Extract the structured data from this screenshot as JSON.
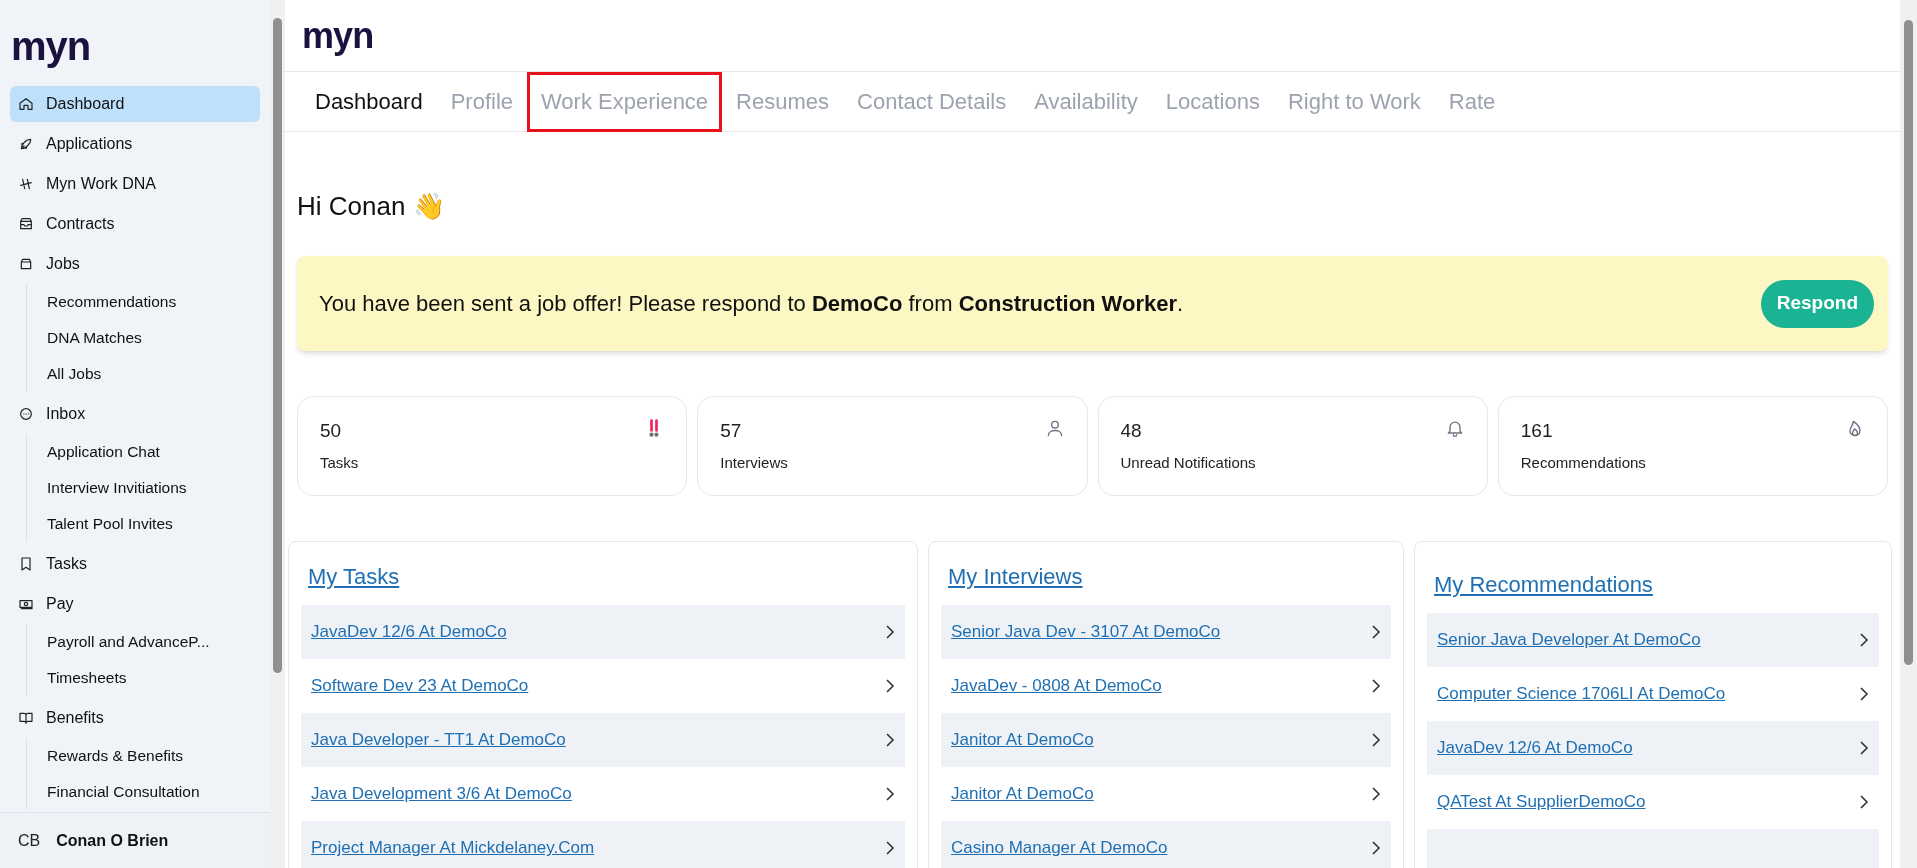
{
  "sidebar": {
    "logo": "myn",
    "items": [
      {
        "label": "Dashboard",
        "selected": true
      },
      {
        "label": "Applications",
        "selected": false
      },
      {
        "label": "Myn Work DNA",
        "selected": false
      },
      {
        "label": "Contracts",
        "selected": false
      },
      {
        "label": "Jobs",
        "selected": false,
        "children": [
          {
            "label": "Recommendations",
            "selected": false
          },
          {
            "label": "DNA Matches",
            "selected": false
          },
          {
            "label": "All Jobs",
            "selected": false
          }
        ]
      },
      {
        "label": "Inbox",
        "selected": false,
        "children": [
          {
            "label": "Application Chat",
            "selected": false
          },
          {
            "label": "Interview Invitiations",
            "selected": false
          },
          {
            "label": "Talent Pool Invites",
            "selected": false
          }
        ]
      },
      {
        "label": "Tasks",
        "selected": false
      },
      {
        "label": "Pay",
        "selected": false,
        "children": [
          {
            "label": "Payroll and AdvanceP...",
            "selected": false
          },
          {
            "label": "Timesheets",
            "selected": false
          }
        ]
      },
      {
        "label": "Benefits",
        "selected": false,
        "children": [
          {
            "label": "Rewards & Benefits",
            "selected": false
          },
          {
            "label": "Financial Consultation",
            "selected": false
          }
        ]
      }
    ],
    "user": {
      "initials": "CB",
      "name": "Conan O Brien"
    }
  },
  "header": {
    "logo": "myn"
  },
  "tabs": [
    {
      "label": "Dashboard",
      "selected": true,
      "highlighted": false
    },
    {
      "label": "Profile",
      "selected": false,
      "highlighted": false
    },
    {
      "label": "Work Experience",
      "selected": false,
      "highlighted": true
    },
    {
      "label": "Resumes",
      "selected": false,
      "highlighted": false
    },
    {
      "label": "Contact Details",
      "selected": false,
      "highlighted": false
    },
    {
      "label": "Availability",
      "selected": false,
      "highlighted": false
    },
    {
      "label": "Locations",
      "selected": false,
      "highlighted": false
    },
    {
      "label": "Right to Work",
      "selected": false,
      "highlighted": false
    },
    {
      "label": "Rate",
      "selected": false,
      "highlighted": false
    }
  ],
  "greeting": "Hi Conan 👋",
  "banner": {
    "message": "You have been sent a job offer! Please respond to **DemoCo** from **Construction Worker**.",
    "button": "Respond"
  },
  "stats": [
    {
      "value": "50",
      "label": "Tasks"
    },
    {
      "value": "57",
      "label": "Interviews"
    },
    {
      "value": "48",
      "label": "Unread Notifications"
    },
    {
      "value": "161",
      "label": "Recommendations"
    }
  ],
  "panels": [
    {
      "title": "My Tasks",
      "rows": [
        "JavaDev 12/6 At DemoCo",
        "Software Dev 23 At DemoCo",
        "Java Developer - TT1 At DemoCo",
        "Java Development 3/6 At DemoCo",
        "Project Manager At Mickdelaney.Com"
      ]
    },
    {
      "title": "My Interviews",
      "rows": [
        "Senior Java Dev - 3107 At DemoCo",
        "JavaDev - 0808 At DemoCo",
        "Janitor At DemoCo",
        "Janitor At DemoCo",
        "Casino Manager At DemoCo"
      ]
    },
    {
      "title": "My Recommendations",
      "rows": [
        "Senior Java Developer At DemoCo",
        "Computer Science 1706LI At DemoCo",
        "JavaDev 12/6 At DemoCo",
        "QATest At SupplierDemoCo"
      ]
    }
  ]
}
